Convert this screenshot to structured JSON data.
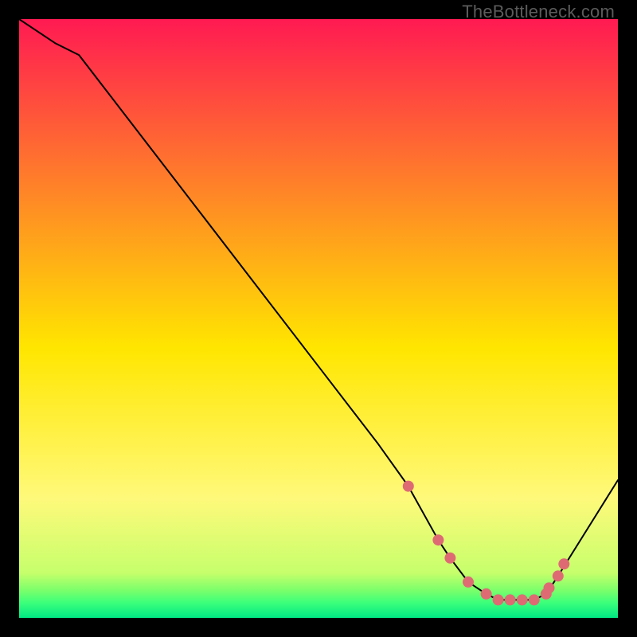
{
  "watermark": "TheBottleneck.com",
  "chart_data": {
    "type": "line",
    "title": "",
    "xlabel": "",
    "ylabel": "",
    "xlim": [
      0,
      100
    ],
    "ylim": [
      0,
      100
    ],
    "x": [
      0,
      6,
      10,
      20,
      30,
      40,
      50,
      60,
      65,
      70,
      72,
      75,
      78,
      80,
      82,
      84,
      86,
      88,
      90,
      100
    ],
    "values": [
      100,
      96,
      94,
      81,
      68,
      55,
      42,
      29,
      22,
      13,
      10,
      6,
      4,
      3,
      3,
      3,
      3,
      4,
      7,
      23
    ],
    "dot_x": [
      65,
      70,
      72,
      75,
      78,
      80,
      82,
      84,
      86,
      88,
      88.5,
      90,
      91
    ],
    "dot_values": [
      22,
      13,
      10,
      6,
      4,
      3,
      3,
      3,
      3,
      4,
      5,
      7,
      9
    ],
    "dot_radius_px": 7,
    "colors": {
      "top": "#ff1a52",
      "mid": "#ffe600",
      "green1": "#c6ff6b",
      "green2": "#77ff6b",
      "green3": "#3bff7b",
      "green4": "#00e884",
      "line": "#000000",
      "dot": "#de6b74"
    }
  }
}
